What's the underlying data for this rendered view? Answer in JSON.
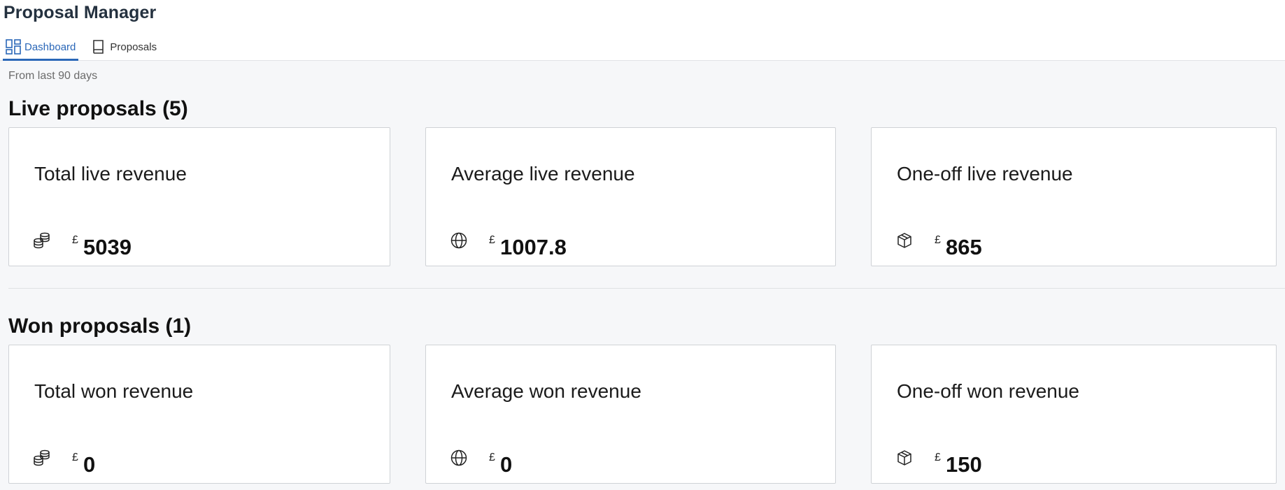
{
  "app": {
    "title": "Proposal Manager"
  },
  "tabs": [
    {
      "label": "Dashboard",
      "icon": "dashboard-icon",
      "active": true
    },
    {
      "label": "Proposals",
      "icon": "book-icon",
      "active": false
    }
  ],
  "period": "From last 90 days",
  "live": {
    "title": "Live proposals (5)",
    "cards": [
      {
        "title": "Total live revenue",
        "icon": "coins-icon",
        "currency": "£",
        "value": "5039"
      },
      {
        "title": "Average live revenue",
        "icon": "globe-icon",
        "currency": "£",
        "value": "1007.8"
      },
      {
        "title": "One-off live revenue",
        "icon": "box-icon",
        "currency": "£",
        "value": "865"
      }
    ]
  },
  "won": {
    "title": "Won proposals (1)",
    "cards": [
      {
        "title": "Total won revenue",
        "icon": "coins-icon",
        "currency": "£",
        "value": "0"
      },
      {
        "title": "Average won revenue",
        "icon": "globe-icon",
        "currency": "£",
        "value": "0"
      },
      {
        "title": "One-off won revenue",
        "icon": "box-icon",
        "currency": "£",
        "value": "150"
      }
    ]
  },
  "colors": {
    "accent": "#2a67b8",
    "background": "#f6f7f9",
    "card_border": "#cfd2d6"
  }
}
